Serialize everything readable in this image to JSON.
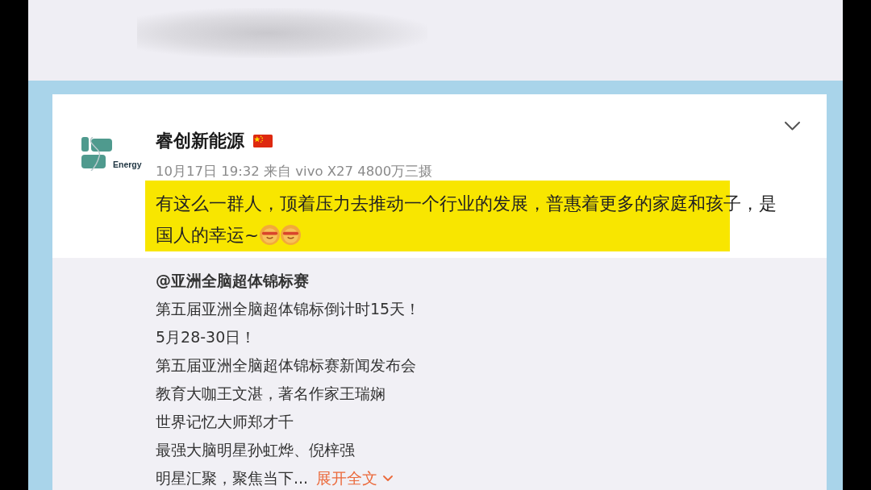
{
  "post": {
    "avatar_label": "Energy",
    "author": "睿创新能源",
    "meta": "10月17日 19:32 来自 vivo X27 4800万三摄",
    "text_lines": [
      "有这么一群人，顶着压力去推动一个行业的发展，普惠着更多的家庭和孩子，是",
      "国人的幸运~"
    ],
    "emojis": [
      {
        "kind": "cheer"
      },
      {
        "kind": "cheer"
      }
    ],
    "highlighted": true
  },
  "repost": {
    "mention": "@亚洲全脑超体锦标赛",
    "lines": [
      "第五届亚洲全脑超体锦标倒计时15天！",
      "5月28-30日！",
      "第五届亚洲全脑超体锦标赛新闻发布会",
      "教育大咖王文湛，著名作家王瑞娴",
      "世界记忆大师郑才千",
      "最强大脑明星孙虹烨、倪梓强"
    ],
    "last_line": "明星汇聚，聚焦当下...",
    "expand_link": "展开全文"
  }
}
